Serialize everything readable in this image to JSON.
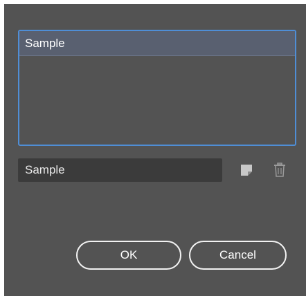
{
  "list": {
    "items": [
      {
        "label": "Sample",
        "selected": true
      }
    ]
  },
  "name_field": {
    "value": "Sample"
  },
  "icons": {
    "new": "new-preset-icon",
    "delete": "trash-icon"
  },
  "buttons": {
    "ok_label": "OK",
    "cancel_label": "Cancel"
  },
  "colors": {
    "background": "#535353",
    "selection": "#596070",
    "focus_border": "#4f8ed6"
  }
}
